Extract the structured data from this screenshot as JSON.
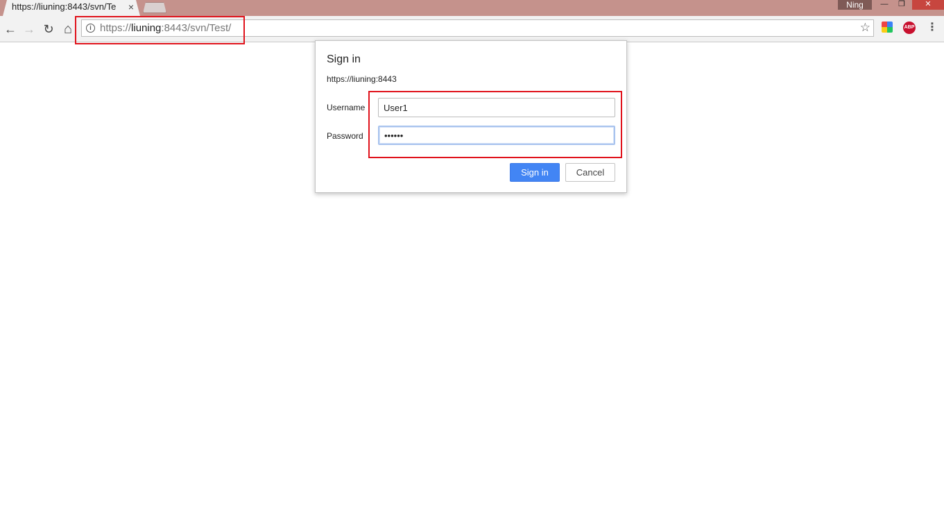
{
  "tab": {
    "title": "https://liuning:8443/svn/Te",
    "close_glyph": "×"
  },
  "window": {
    "profile_name": "Ning",
    "minimize_glyph": "—",
    "restore_glyph": "❐",
    "close_glyph": "✕"
  },
  "toolbar": {
    "back_glyph": "←",
    "forward_glyph": "→",
    "reload_glyph": "↻",
    "home_glyph": "⌂",
    "url_scheme": "https://",
    "url_host": "liuning",
    "url_rest": ":8443/svn/Test/",
    "info_glyph": "i",
    "star_glyph": "☆",
    "abp_label": "ABP",
    "menu_glyph": "⋮"
  },
  "dialog": {
    "title": "Sign in",
    "origin": "https://liuning:8443",
    "username_label": "Username",
    "username_value": "User1",
    "password_label": "Password",
    "password_value": "••••••",
    "signin_label": "Sign in",
    "cancel_label": "Cancel"
  },
  "colors": {
    "frame": "#c5928c",
    "primary_button": "#4285f4",
    "annotation_box": "#e0121b"
  },
  "icons": [
    "back-icon",
    "forward-icon",
    "reload-icon",
    "home-icon",
    "info-icon",
    "bookmark-star-icon",
    "extension-icon",
    "adblock-plus-icon",
    "menu-icon",
    "tab-close-icon"
  ]
}
